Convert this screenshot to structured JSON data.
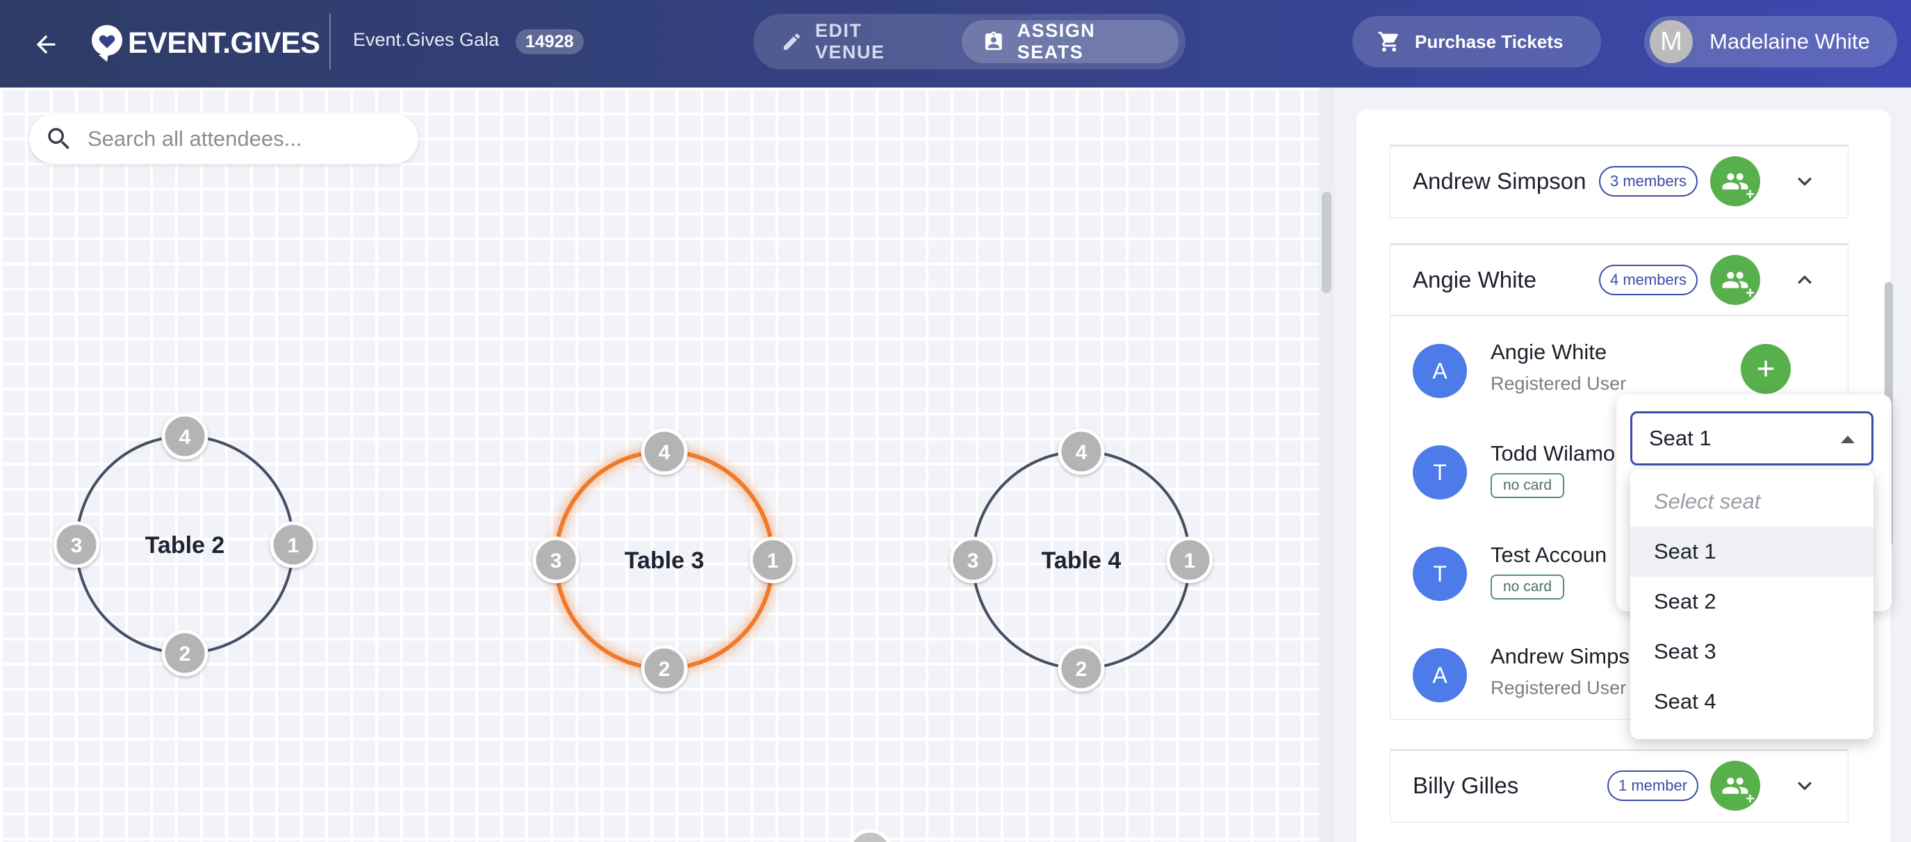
{
  "header": {
    "logo_text": "EVENT.GIVES",
    "event_name": "Event.Gives Gala",
    "event_id": "14928",
    "modes": [
      {
        "label": "EDIT VENUE",
        "active": false
      },
      {
        "label": "ASSIGN SEATS",
        "active": true
      }
    ],
    "purchase_label": "Purchase Tickets",
    "user": {
      "initial": "M",
      "name": "Madelaine White"
    }
  },
  "search": {
    "placeholder": "Search all attendees..."
  },
  "tables": [
    {
      "name": "Table 2",
      "seats": [
        "1",
        "2",
        "3",
        "4"
      ],
      "selected": false
    },
    {
      "name": "Table 3",
      "seats": [
        "1",
        "2",
        "3",
        "4"
      ],
      "selected": true
    },
    {
      "name": "Table 4",
      "seats": [
        "1",
        "2",
        "3",
        "4"
      ],
      "selected": false
    }
  ],
  "colors": {
    "accent": "#3d4aa8",
    "add_green": "#58b04c",
    "avatar_blue": "#4d7bea",
    "selected_table": "#f07a2a",
    "table_ring": "#474d63",
    "seat_fill": "#b4b4b4"
  },
  "groups": [
    {
      "name": "Andrew Simpson",
      "members_label": "3 members",
      "expanded": false,
      "members": []
    },
    {
      "name": "Angie White",
      "members_label": "4 members",
      "expanded": true,
      "members": [
        {
          "initial": "A",
          "name": "Angie White",
          "role": "Registered User",
          "badge": ""
        },
        {
          "initial": "T",
          "name": "Todd Wilamo",
          "role": "",
          "badge": "no card"
        },
        {
          "initial": "T",
          "name": "Test Accoun",
          "role": "",
          "badge": "no card"
        },
        {
          "initial": "A",
          "name": "Andrew Simps",
          "role": "Registered User",
          "badge": ""
        }
      ]
    },
    {
      "name": "Billy Gilles",
      "members_label": "1 member",
      "expanded": false,
      "members": []
    }
  ],
  "seat_select": {
    "value": "Seat 1",
    "options": [
      {
        "label": "Select seat",
        "placeholder": true
      },
      {
        "label": "Seat 1",
        "selected": true
      },
      {
        "label": "Seat 2"
      },
      {
        "label": "Seat 3"
      },
      {
        "label": "Seat 4"
      }
    ]
  },
  "icons": {
    "back": "arrow-left-icon",
    "logo": "heart-pin-icon",
    "edit": "pencil-icon",
    "assign": "clipboard-person-icon",
    "cart": "cart-icon",
    "search": "search-icon",
    "add_group": "group-add-icon",
    "expand": "chevron-down-icon",
    "collapse": "chevron-up-icon"
  }
}
